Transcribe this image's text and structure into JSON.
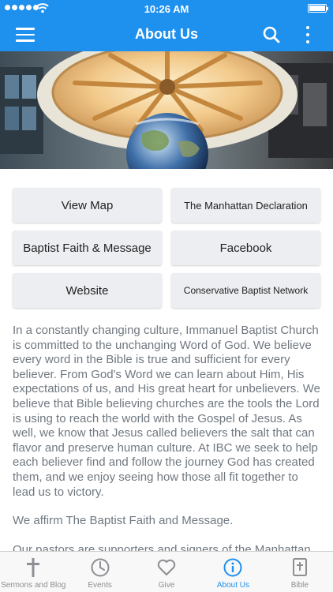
{
  "status_bar": {
    "time": "10:26 AM"
  },
  "app_bar": {
    "title": "About Us",
    "menu_icon": "hamburger-menu-icon",
    "search_icon": "search-icon",
    "more_icon": "more-vertical-icon"
  },
  "hero": {
    "description_icon": "church-dome-globe-photo"
  },
  "links": [
    {
      "label": "View Map"
    },
    {
      "label": "The Manhattan Declaration"
    },
    {
      "label": "Baptist Faith & Message"
    },
    {
      "label": "Facebook"
    },
    {
      "label": "Website"
    },
    {
      "label": "Conservative Baptist Network"
    }
  ],
  "content": {
    "paragraphs": [
      "In a constantly changing culture, Immanuel Baptist Church is committed to the unchanging Word of God.  We believe every word in the Bible is true and sufficient for every believer.  From God's Word we can learn about Him, His expectations of us, and His great heart for unbelievers. We believe that Bible believing churches are the tools the Lord is using to reach the world with the Gospel of Jesus. As well, we know that Jesus called believers the salt that can flavor and preserve human culture.  At IBC we seek to help each believer find and follow the journey God has created them, and we enjoy seeing how those all fit together to lead us to victory.",
      "We affirm The Baptist Faith and Message.",
      "Our pastors are supporters and signers of the Manhattan Declaration and the Conservative Baptist Network."
    ]
  },
  "tabs": [
    {
      "label": "Sermons and Blog",
      "icon": "cross-icon"
    },
    {
      "label": "Events",
      "icon": "clock-icon"
    },
    {
      "label": "Give",
      "icon": "heart-icon"
    },
    {
      "label": "About Us",
      "icon": "info-icon",
      "active": true
    },
    {
      "label": "Bible",
      "icon": "bible-icon"
    }
  ],
  "colors": {
    "accent": "#1e90ee",
    "tab_inactive": "#8e8e93",
    "body_text": "#707880",
    "button_bg": "#eceef1"
  }
}
